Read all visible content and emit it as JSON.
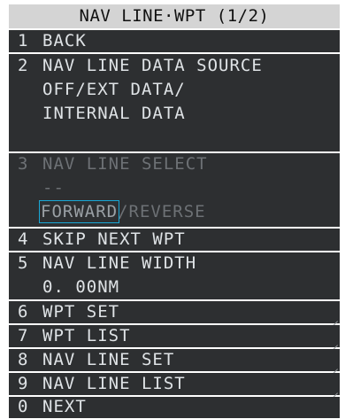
{
  "menu": {
    "title": "NAV LINE·WPT (1/2)",
    "items": [
      {
        "num": "1",
        "label": "BACK"
      },
      {
        "num": "2",
        "label": "NAV LINE DATA SOURCE",
        "options_line1": "OFF/EXT DATA/",
        "options_line2": "INTERNAL DATA"
      },
      {
        "num": "3",
        "label": "NAV LINE SELECT",
        "value": "--",
        "option_selected": "FORWARD",
        "option_other": "/REVERSE"
      },
      {
        "num": "4",
        "label": "SKIP NEXT WPT"
      },
      {
        "num": "5",
        "label": "NAV LINE WIDTH",
        "value": "0. 00NM"
      },
      {
        "num": "6",
        "label": "WPT SET"
      },
      {
        "num": "7",
        "label": "WPT LIST"
      },
      {
        "num": "8",
        "label": "NAV LINE SET"
      },
      {
        "num": "9",
        "label": "NAV LINE LIST"
      },
      {
        "num": "0",
        "label": "NEXT"
      }
    ]
  },
  "colors": {
    "panel": "#2d2f31",
    "title_bar": "#d4d4d4",
    "text": "#dfe3e6",
    "disabled_text": "#6d7175",
    "selection": "#19a8d6"
  }
}
